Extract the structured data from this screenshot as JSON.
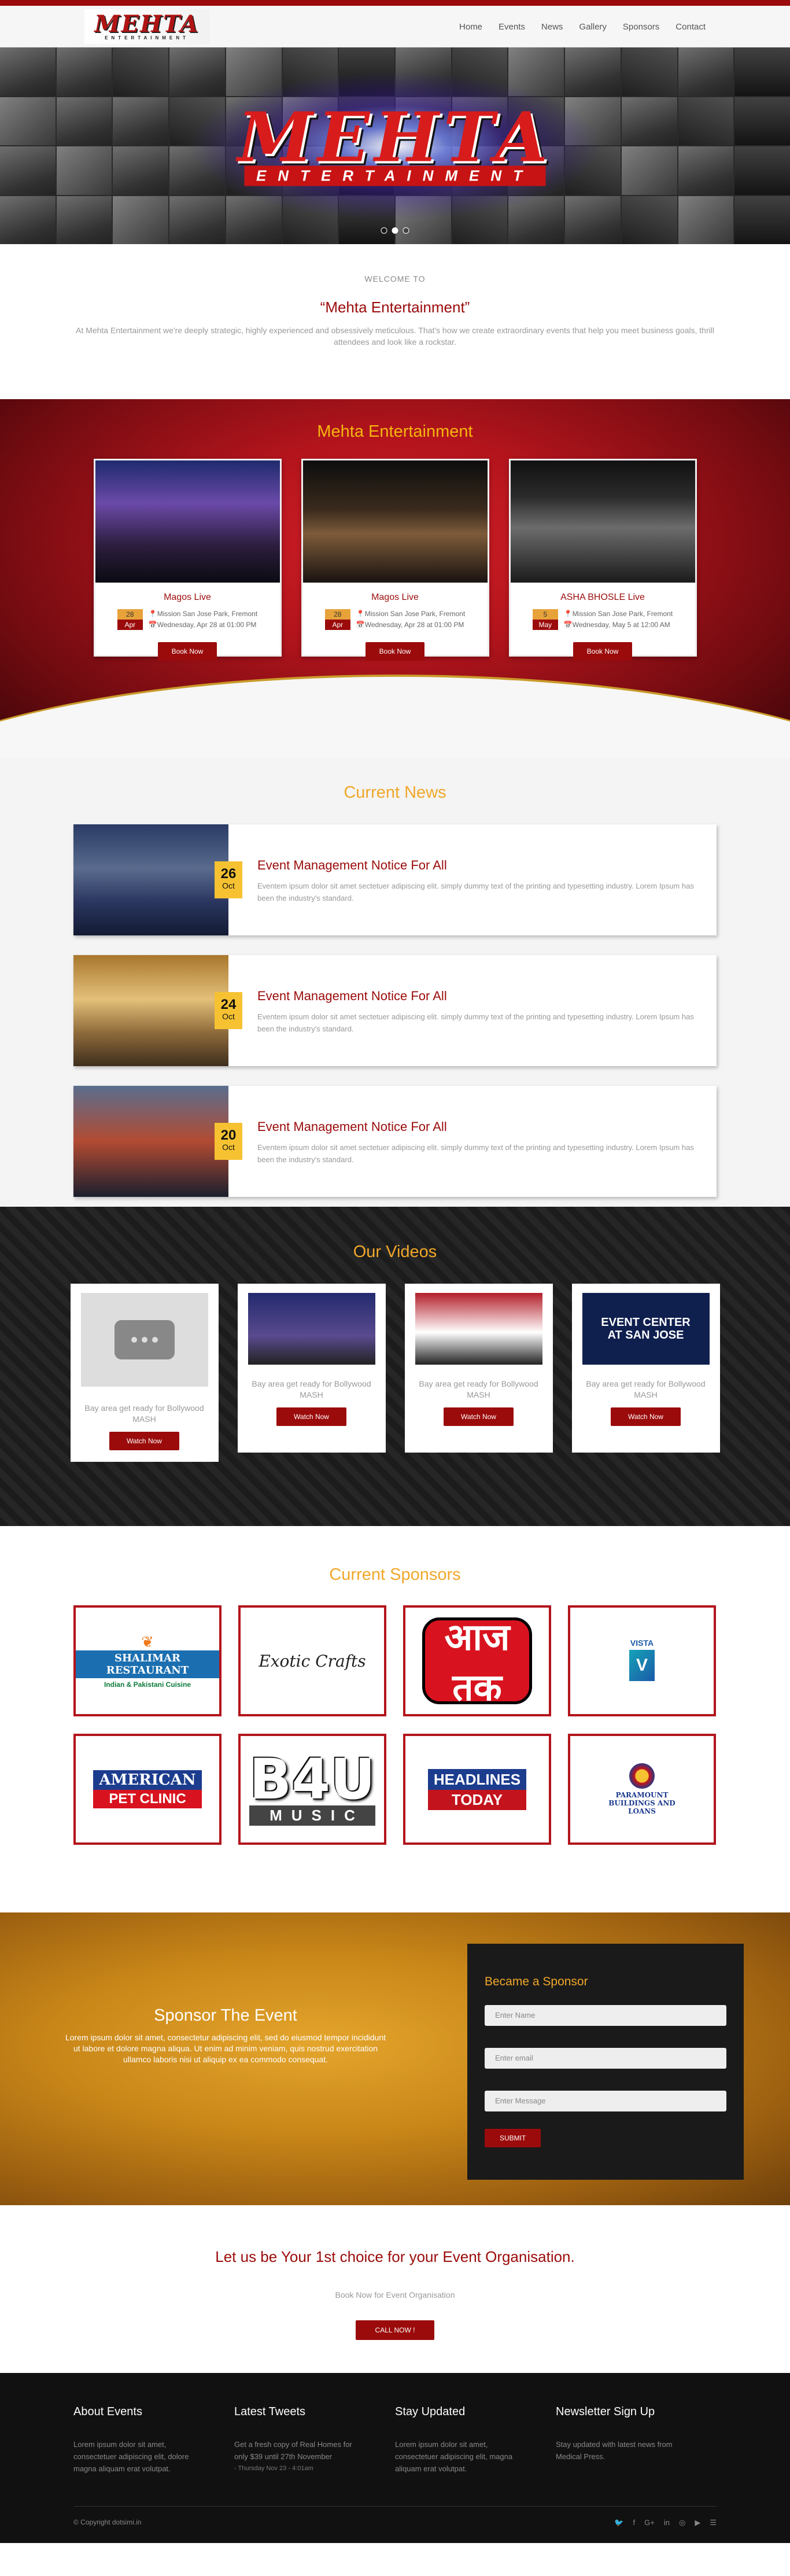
{
  "header": {
    "logo_main": "MEHTA",
    "logo_sub": "ENTERTAINMENT",
    "nav": [
      "Home",
      "Events",
      "News",
      "Gallery",
      "Sponsors",
      "Contact"
    ]
  },
  "hero": {
    "logo_main": "MEHTA",
    "logo_sub": "ENTERTAINMENT",
    "slides": 3,
    "active_slide": 2
  },
  "welcome": {
    "small": "WELCOME TO",
    "title": "“Mehta Entertainment”",
    "text": "At Mehta Entertainment we're deeply strategic, highly experienced and obsessively meticulous. That's how we create extraordinary events that help you meet business goals, thrill attendees and look like a rockstar."
  },
  "events": {
    "title": "Mehta Entertainment",
    "cards": [
      {
        "name": "Magos Live",
        "day": "28",
        "month": "Apr",
        "location": "Mission San Jose Park, Fremont",
        "datetime": "Wednesday, Apr 28 at 01:00 PM",
        "button": "Book Now"
      },
      {
        "name": "Magos Live",
        "day": "28",
        "month": "Apr",
        "location": "Mission San Jose Park, Fremont",
        "datetime": "Wednesday, Apr 28 at 01:00 PM",
        "button": "Book Now"
      },
      {
        "name": "ASHA BHOSLE Live",
        "day": "5",
        "month": "May",
        "location": "Mission San Jose Park, Fremont",
        "datetime": "Wednesday, May 5 at 12:00 AM",
        "button": "Book Now"
      }
    ]
  },
  "news": {
    "title": "Current News",
    "items": [
      {
        "day": "26",
        "month": "Oct",
        "title": "Event Management Notice For All",
        "text": "Eventem ipsum dolor sit amet sectetuer adipiscing elit. simply dummy text of the printing and typesetting industry. Lorem Ipsum has been the industry's standard."
      },
      {
        "day": "24",
        "month": "Oct",
        "title": "Event Management Notice For All",
        "text": "Eventem ipsum dolor sit amet sectetuer adipiscing elit. simply dummy text of the printing and typesetting industry. Lorem Ipsum has been the industry's standard."
      },
      {
        "day": "20",
        "month": "Oct",
        "title": "Event Management Notice For All",
        "text": "Eventem ipsum dolor sit amet sectetuer adipiscing elit. simply dummy text of the printing and typesetting industry. Lorem Ipsum has been the industry's standard."
      }
    ]
  },
  "videos": {
    "title": "Our Videos",
    "cards": [
      {
        "caption": "Bay area get ready for Bollywood MASH",
        "button": "Watch Now"
      },
      {
        "caption": "Bay area get ready for Bollywood MASH",
        "button": "Watch Now"
      },
      {
        "caption": "Bay area get ready for Bollywood MASH",
        "button": "Watch Now"
      },
      {
        "caption": "Bay area get ready for Bollywood MASH",
        "button": "Watch Now",
        "thumb_text_1": "EVENT CENTER",
        "thumb_text_2": "AT SAN JOSE"
      }
    ]
  },
  "sponsors": {
    "title": "Current Sponsors",
    "logos": {
      "s1": {
        "name": "SHALIMAR RESTAURANT",
        "sub": "Indian & Pakistani Cuisine"
      },
      "s2": {
        "name": "Exotic Crafts"
      },
      "s3": {
        "name": "आज तक"
      },
      "s4": {
        "name": "VISTA"
      },
      "s5": {
        "name": "AMERICAN",
        "sub": "PET CLINIC"
      },
      "s6": {
        "name": "B4U",
        "sub": "MUSIC"
      },
      "s7": {
        "name": "HEADLINES",
        "sub": "TODAY"
      },
      "s8": {
        "name": "PARAMOUNT BUILDINGS AND LOANS"
      }
    }
  },
  "become": {
    "title": "Sponsor The Event",
    "text": "Lorem ipsum dolor sit amet, consectetur adipiscing elit, sed do eiusmod tempor incididunt ut labore et dolore magna aliqua. Ut enim ad minim veniam, quis nostrud exercitation ullamco laboris nisi ut aliquip ex ea commodo consequat.",
    "form_title": "Became a Sponsor",
    "name_placeholder": "Enter Name",
    "email_placeholder": "Enter email",
    "message_placeholder": "Enter Message",
    "submit": "SUBMIT"
  },
  "cta": {
    "title": "Let us be Your 1st choice for your Event Organisation.",
    "subtitle": "Book Now for Event Organisation",
    "button": "CALL NOW !"
  },
  "footer": {
    "about_title": "About Events",
    "about_text": "Lorem ipsum dolor sit amet, consectetuer adipiscing elit, dolore magna aliquam erat volutpat.",
    "tweets_title": "Latest Tweets",
    "tweet_text": "Get a fresh copy of Real Homes for only $39 until 27th November",
    "tweet_date": "- Thursday Nov 23 - 4:01am",
    "stay_title": "Stay Updated",
    "stay_text": "Lorem ipsum dolor sit amet, consectetuer adipiscing elit, magna aliquam erat volutpat.",
    "news_title": "Newsletter Sign Up",
    "news_text": "Stay updated with latest news from Medical Press.",
    "copyright": "© Copyright dotsimi.in",
    "social": [
      "twitter-icon",
      "facebook-icon",
      "google-plus-icon",
      "linkedin-icon",
      "instagram-icon",
      "youtube-icon",
      "rss-icon"
    ]
  }
}
